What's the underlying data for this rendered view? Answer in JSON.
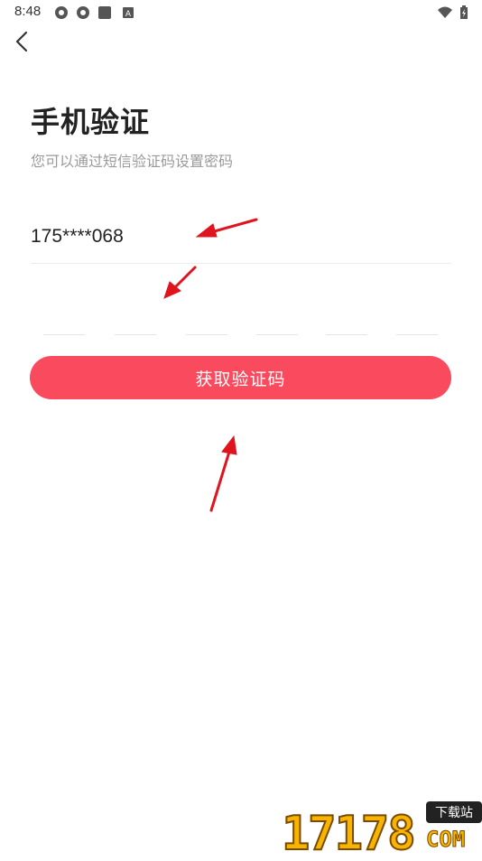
{
  "status_bar": {
    "time": "8:48",
    "icons": [
      "vpn-icon",
      "vpn-icon",
      "square-icon",
      "font-icon",
      "wifi-icon",
      "battery-icon"
    ]
  },
  "header": {
    "back_icon": "chevron-left-icon"
  },
  "page": {
    "title": "手机验证",
    "subtitle": "您可以通过短信验证码设置密码"
  },
  "form": {
    "phone_masked": "175****068",
    "code_slots": 6,
    "button_label": "获取验证码"
  },
  "colors": {
    "accent": "#fa4a5d",
    "arrow": "#e0141e"
  },
  "watermark": {
    "digits": "17178",
    "badge": "下载站",
    "suffix": "COM"
  }
}
